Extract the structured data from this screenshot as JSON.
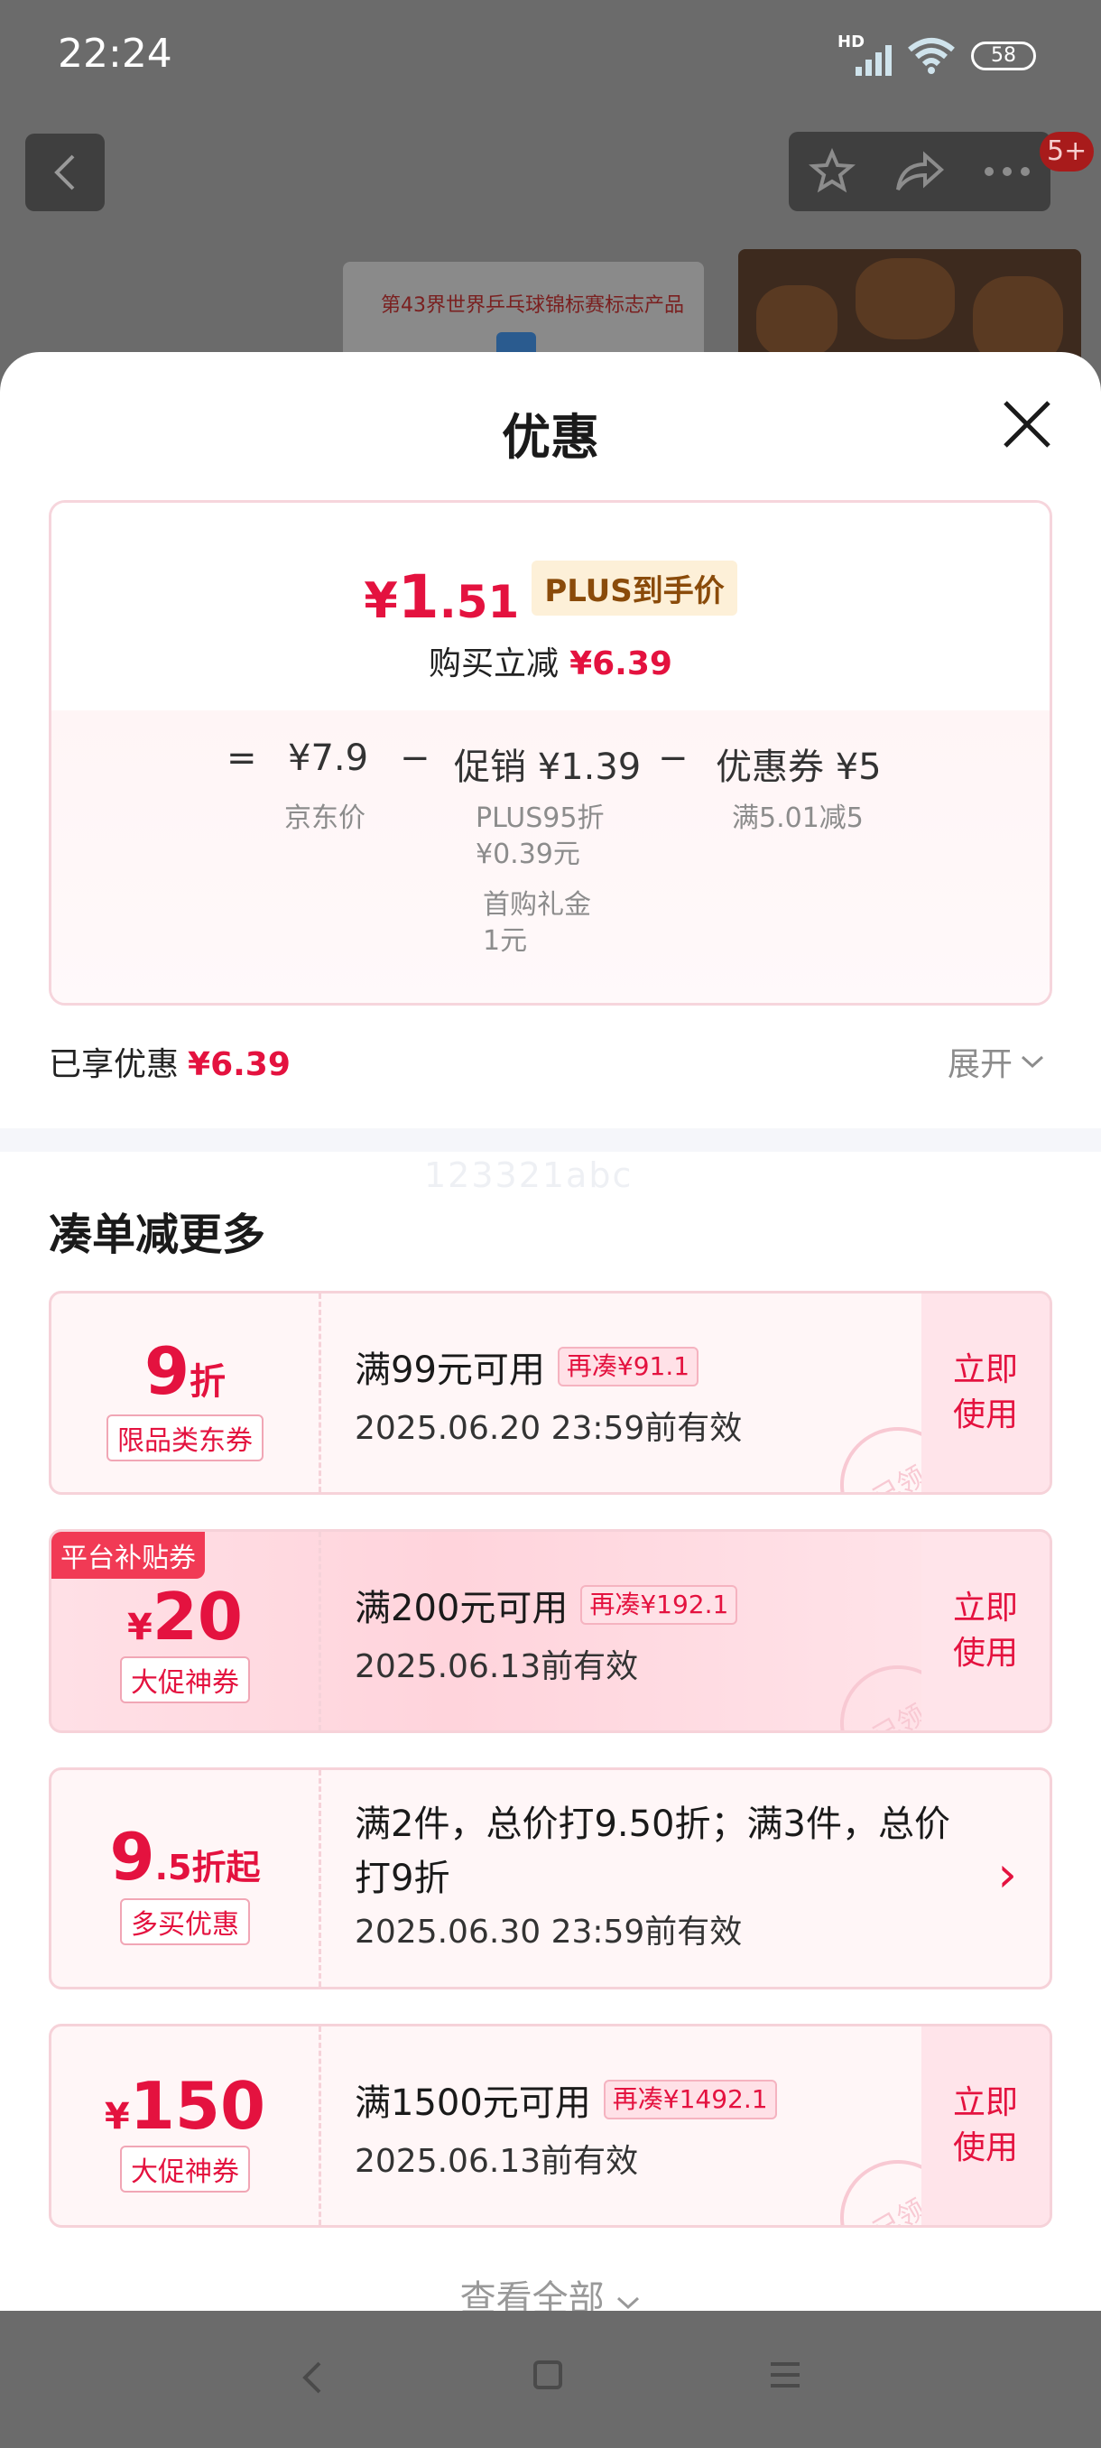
{
  "status_bar": {
    "time": "22:24",
    "network": "HD",
    "battery": "58"
  },
  "background_page": {
    "badge": "5+",
    "product_banner": "第43界世界乒乓球锦标赛标志产品"
  },
  "sheet": {
    "title": "优惠",
    "summary": {
      "final_price": {
        "currency": "¥",
        "integer": "1",
        "decimal": ".51"
      },
      "plus_tag": "PLUS到手价",
      "reduce_label": "购买立减",
      "reduce_amount": "¥6.39",
      "calc": {
        "equals": "=",
        "jd_price": "¥7.9",
        "minus1": "−",
        "promo": "促销 ¥1.39",
        "minus2": "−",
        "coupon": "优惠券 ¥5",
        "jd_price_label": "京东价",
        "promo_detail1": "PLUS95折",
        "promo_detail2": "¥0.39元",
        "promo_detail3": "首购礼金",
        "promo_detail4": "1元",
        "coupon_detail": "满5.01减5"
      }
    },
    "enjoyed": {
      "label": "已享优惠",
      "amount": "¥6.39",
      "expand": "展开"
    },
    "watermark": "123321abc",
    "section_title": "凑单减更多",
    "coupons": [
      {
        "amount_main": "9",
        "amount_suffix": "折",
        "type": "限品类东券",
        "condition": "满99元可用",
        "extra": "再凑¥91.1",
        "date": "2025.06.20 23:59前有效",
        "action_line1": "立即",
        "action_line2": "使用",
        "stamp": "已领"
      },
      {
        "platform_tag": "平台补贴券",
        "currency": "¥",
        "amount_main": "20",
        "type": "大促神券",
        "condition": "满200元可用",
        "extra": "再凑¥192.1",
        "date": "2025.06.13前有效",
        "action_line1": "立即",
        "action_line2": "使用",
        "stamp": "已领"
      },
      {
        "amount_main": "9",
        "amount_suffix": ".5折起",
        "type": "多买优惠",
        "condition": "满2件，总价打9.50折；满3件，总价打9折",
        "date": "2025.06.30 23:59前有效",
        "arrow": "›"
      },
      {
        "currency": "¥",
        "amount_main": "150",
        "type": "大促神券",
        "condition": "满1500元可用",
        "extra": "再凑¥1492.1",
        "date": "2025.06.13前有效",
        "action_line1": "立即",
        "action_line2": "使用",
        "stamp": "已领"
      }
    ],
    "view_all": "查看全部"
  },
  "colors": {
    "accent": "#e4123f",
    "plus_bg": "#fdf0d8",
    "coupon_bg": "#fff6f7"
  }
}
